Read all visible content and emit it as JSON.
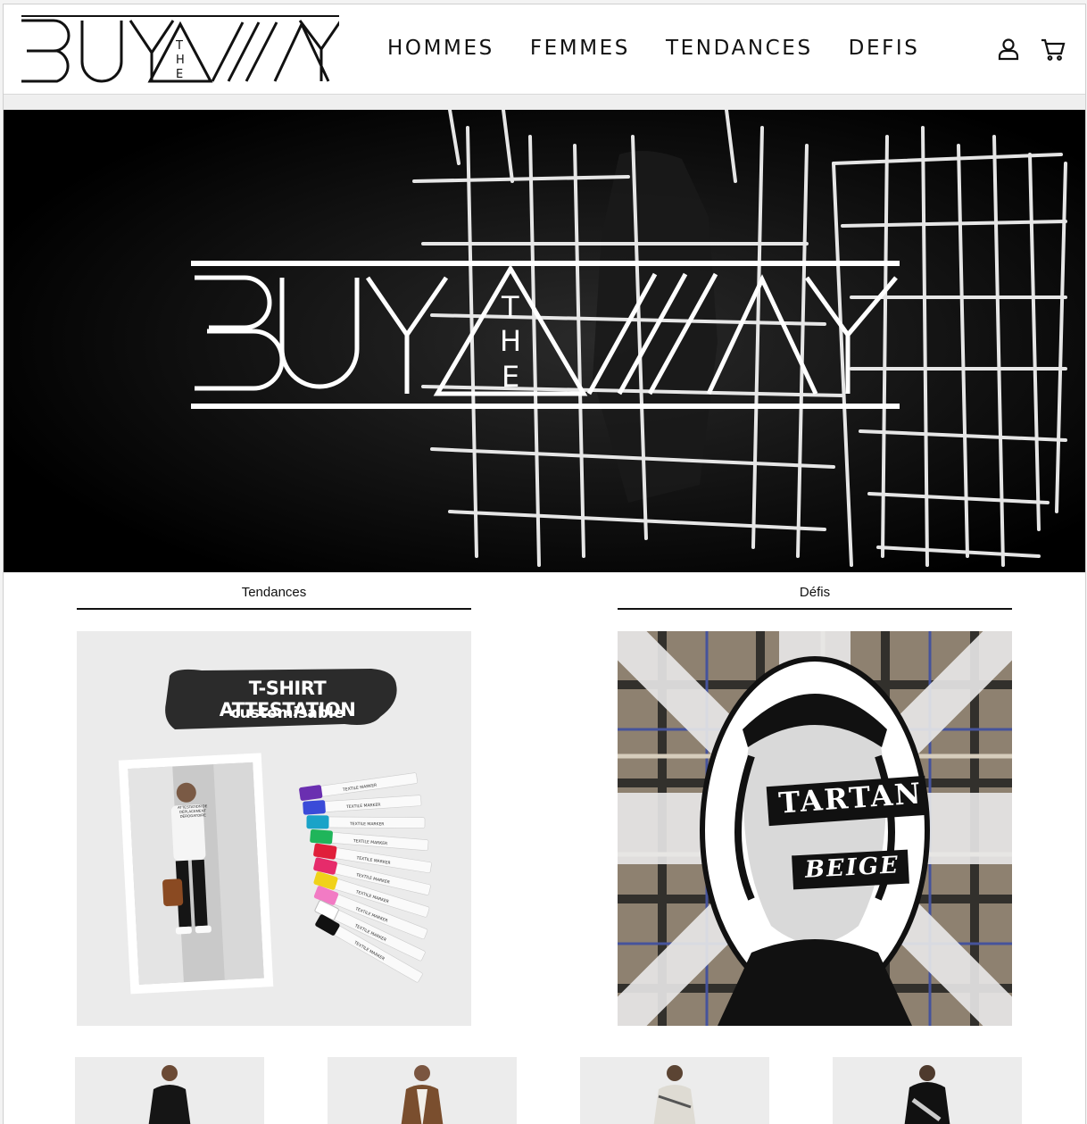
{
  "brand": {
    "name": "BUYAWAY",
    "tagline": "THE"
  },
  "nav": {
    "items": [
      "HOMMES",
      "FEMMES",
      "TENDANCES",
      "DEFIS"
    ]
  },
  "header_icons": [
    "account-icon",
    "cart-icon"
  ],
  "hero": {
    "logo_text": "BUYAWAY",
    "logo_small": "THE"
  },
  "sections": {
    "left": {
      "title": "Tendances",
      "promo": {
        "banner_title": "T-SHIRT ATTESTATION",
        "banner_sub": "customisable",
        "shirt_text": "ATTESTATION DE DÉPLACEMENT DÉROGATOIRE",
        "marker_label": "TEXTILE MARKER"
      }
    },
    "right": {
      "title": "Défis",
      "promo": {
        "word1": "TARTAN",
        "word2": "BEIGE"
      }
    }
  },
  "colors": {
    "background": "#ffffff",
    "hero_bg": "#000000",
    "text": "#111111",
    "marker_colors": [
      "#6a2fb0",
      "#3a4bd8",
      "#1aa3c8",
      "#1fb55a",
      "#e01f3a",
      "#e62b6b",
      "#f0d21a",
      "#f27bc4",
      "#ffffff",
      "#111111"
    ]
  },
  "thumbnails": [
    "product-thumb-1",
    "product-thumb-2",
    "product-thumb-3",
    "product-thumb-4"
  ]
}
